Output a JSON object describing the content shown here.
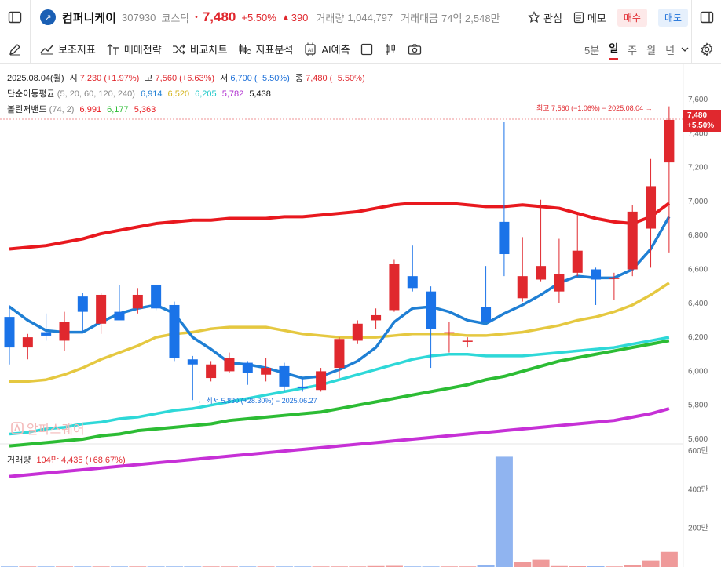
{
  "header": {
    "company_name": "컴퍼니케이",
    "code": "307930",
    "market": "코스닥",
    "price": "7,480",
    "change_pct": "+5.50%",
    "change_amt": "390",
    "volume_label": "거래량",
    "volume": "1,044,797",
    "amount_label": "거래대금",
    "amount": "74억 2,548만",
    "interest_label": "관심",
    "memo_label": "메모",
    "buy_label": "매수",
    "sell_label": "매도"
  },
  "toolbar": {
    "items": [
      "보조지표",
      "매매전략",
      "비교차트",
      "지표분석",
      "AI예측"
    ],
    "periods": [
      "5분",
      "일",
      "주",
      "월",
      "년"
    ],
    "active_period": "일"
  },
  "legend": {
    "date": "2025.08.04(월)",
    "open_label": "시",
    "open": "7,230 (+1.97%)",
    "high_label": "고",
    "high": "7,560 (+6.63%)",
    "low_label": "저",
    "low": "6,700 (−5.50%)",
    "close_label": "종",
    "close": "7,480 (+5.50%)",
    "ma_label": "단순이동평균",
    "ma_params": "(5, 20, 60, 120, 240)",
    "ma_values": [
      "6,914",
      "6,520",
      "6,205",
      "5,782",
      "5,438"
    ],
    "bb_label": "볼린저밴드",
    "bb_params": "(74, 2)",
    "bb_values": [
      "6,991",
      "6,177",
      "5,363"
    ]
  },
  "annotations": {
    "high": "최고 7,560 (−1.06%) − 2025.08.04",
    "low": "최저 5,830 (+28.30%) − 2025.06.27",
    "price_tag": "7,480",
    "price_tag_pct": "+5.50%"
  },
  "colors": {
    "up": "#e0282e",
    "down": "#1a73e8",
    "ma5": "#1f7fd4",
    "ma20": "#e5c840",
    "ma60": "#2ed8d8",
    "bb_upper": "#e8181e",
    "bb_mid": "#2cbc34",
    "bb_lower": "#c630d6"
  },
  "volume_legend": {
    "label": "거래량",
    "value": "104만 4,435 (+68.67%)"
  },
  "watermark": "알파스퀘어",
  "chart_data": {
    "type": "candlestick",
    "y_ticks": [
      "7,600",
      "7,400",
      "7,200",
      "7,000",
      "6,800",
      "6,600",
      "6,400",
      "6,200",
      "6,000",
      "5,800",
      "5,600"
    ],
    "ylim": [
      5600,
      7600
    ],
    "candles": [
      {
        "o": 6320,
        "h": 6390,
        "l": 6040,
        "c": 6140
      },
      {
        "o": 6140,
        "h": 6220,
        "l": 6070,
        "c": 6200
      },
      {
        "o": 6230,
        "h": 6340,
        "l": 6180,
        "c": 6210
      },
      {
        "o": 6180,
        "h": 6350,
        "l": 6120,
        "c": 6290
      },
      {
        "o": 6440,
        "h": 6460,
        "l": 6230,
        "c": 6350
      },
      {
        "o": 6280,
        "h": 6460,
        "l": 6220,
        "c": 6450
      },
      {
        "o": 6350,
        "h": 6510,
        "l": 6310,
        "c": 6300
      },
      {
        "o": 6370,
        "h": 6490,
        "l": 6340,
        "c": 6450
      },
      {
        "o": 6510,
        "h": 6510,
        "l": 6360,
        "c": 6370
      },
      {
        "o": 6390,
        "h": 6410,
        "l": 6060,
        "c": 6080
      },
      {
        "o": 6070,
        "h": 6090,
        "l": 5830,
        "c": 6040
      },
      {
        "o": 5960,
        "h": 6060,
        "l": 5940,
        "c": 6040
      },
      {
        "o": 6000,
        "h": 6110,
        "l": 5990,
        "c": 6080
      },
      {
        "o": 6050,
        "h": 6060,
        "l": 5920,
        "c": 5990
      },
      {
        "o": 5980,
        "h": 6080,
        "l": 5940,
        "c": 6020
      },
      {
        "o": 6030,
        "h": 6050,
        "l": 5880,
        "c": 5910
      },
      {
        "o": 5910,
        "h": 5960,
        "l": 5880,
        "c": 5900
      },
      {
        "o": 5890,
        "h": 6020,
        "l": 5880,
        "c": 6000
      },
      {
        "o": 6020,
        "h": 6200,
        "l": 5960,
        "c": 6190
      },
      {
        "o": 6180,
        "h": 6300,
        "l": 6160,
        "c": 6280
      },
      {
        "o": 6300,
        "h": 6370,
        "l": 6250,
        "c": 6330
      },
      {
        "o": 6360,
        "h": 6660,
        "l": 6350,
        "c": 6630
      },
      {
        "o": 6560,
        "h": 6740,
        "l": 6470,
        "c": 6490
      },
      {
        "o": 6470,
        "h": 6500,
        "l": 6020,
        "c": 6250
      },
      {
        "o": 6230,
        "h": 6290,
        "l": 6110,
        "c": 6230
      },
      {
        "o": 6180,
        "h": 6200,
        "l": 6140,
        "c": 6180
      },
      {
        "o": 6380,
        "h": 6620,
        "l": 6300,
        "c": 6290
      },
      {
        "o": 6880,
        "h": 7470,
        "l": 6560,
        "c": 6690
      },
      {
        "o": 6430,
        "h": 6790,
        "l": 6410,
        "c": 6560
      },
      {
        "o": 6540,
        "h": 7010,
        "l": 6530,
        "c": 6620
      },
      {
        "o": 6470,
        "h": 6780,
        "l": 6400,
        "c": 6570
      },
      {
        "o": 6580,
        "h": 6920,
        "l": 6560,
        "c": 6710
      },
      {
        "o": 6600,
        "h": 6610,
        "l": 6390,
        "c": 6540
      },
      {
        "o": 6550,
        "h": 6580,
        "l": 6420,
        "c": 6550
      },
      {
        "o": 6600,
        "h": 6980,
        "l": 6560,
        "c": 6940
      },
      {
        "o": 6840,
        "h": 7250,
        "l": 6610,
        "c": 7090
      },
      {
        "o": 7230,
        "h": 7560,
        "l": 6700,
        "c": 7480
      }
    ],
    "ma5": [
      6380,
      6300,
      6240,
      6230,
      6230,
      6290,
      6340,
      6370,
      6390,
      6340,
      6200,
      6130,
      6050,
      6040,
      6020,
      5990,
      5960,
      5970,
      6010,
      6060,
      6140,
      6290,
      6370,
      6380,
      6350,
      6300,
      6280,
      6340,
      6390,
      6450,
      6520,
      6560,
      6550,
      6550,
      6600,
      6720,
      6910
    ],
    "ma20": [
      5940,
      5940,
      5950,
      5980,
      6020,
      6070,
      6110,
      6150,
      6200,
      6220,
      6230,
      6250,
      6260,
      6260,
      6260,
      6240,
      6220,
      6210,
      6200,
      6200,
      6200,
      6210,
      6220,
      6220,
      6220,
      6210,
      6210,
      6220,
      6230,
      6250,
      6270,
      6300,
      6320,
      6350,
      6390,
      6450,
      6520
    ],
    "ma60": [
      5630,
      5640,
      5660,
      5670,
      5690,
      5700,
      5720,
      5730,
      5750,
      5770,
      5780,
      5800,
      5820,
      5840,
      5860,
      5880,
      5900,
      5920,
      5950,
      5980,
      6010,
      6040,
      6070,
      6090,
      6100,
      6100,
      6090,
      6090,
      6090,
      6100,
      6110,
      6120,
      6130,
      6140,
      6160,
      6180,
      6200
    ],
    "bb_upper": [
      6720,
      6730,
      6740,
      6760,
      6780,
      6810,
      6830,
      6850,
      6870,
      6880,
      6890,
      6890,
      6900,
      6900,
      6900,
      6910,
      6910,
      6920,
      6930,
      6940,
      6960,
      6980,
      6990,
      6990,
      6990,
      6980,
      6970,
      6970,
      6980,
      6970,
      6960,
      6930,
      6900,
      6880,
      6870,
      6910,
      6990
    ],
    "bb_mid": [
      5560,
      5570,
      5580,
      5590,
      5600,
      5620,
      5630,
      5650,
      5660,
      5670,
      5680,
      5690,
      5710,
      5720,
      5730,
      5740,
      5750,
      5760,
      5780,
      5800,
      5820,
      5840,
      5860,
      5880,
      5900,
      5920,
      5950,
      5970,
      6000,
      6030,
      6060,
      6080,
      6100,
      6120,
      6140,
      6160,
      6180
    ],
    "bb_lower": [
      5380,
      5390,
      5400,
      5410,
      5420,
      5430,
      5440,
      5450,
      5460,
      5470,
      5480,
      5490,
      5500,
      5510,
      5520,
      5530,
      5540,
      5550,
      5560,
      5570,
      5580,
      5590,
      5600,
      5610,
      5620,
      5630,
      5640,
      5650,
      5660,
      5670,
      5680,
      5690,
      5700,
      5710,
      5730,
      5750,
      5780
    ],
    "volume_ticks": [
      "600만",
      "400만",
      "200만"
    ],
    "volume_ylim": [
      0,
      6000000
    ],
    "volume": [
      30000,
      30000,
      30000,
      30000,
      30000,
      30000,
      30000,
      30000,
      30000,
      30000,
      30000,
      30000,
      30000,
      30000,
      30000,
      30000,
      30000,
      30000,
      30000,
      30000,
      50000,
      60000,
      30000,
      30000,
      30000,
      30000,
      100000,
      5700000,
      250000,
      380000,
      50000,
      40000,
      40000,
      30000,
      110000,
      340000,
      780000
    ]
  }
}
